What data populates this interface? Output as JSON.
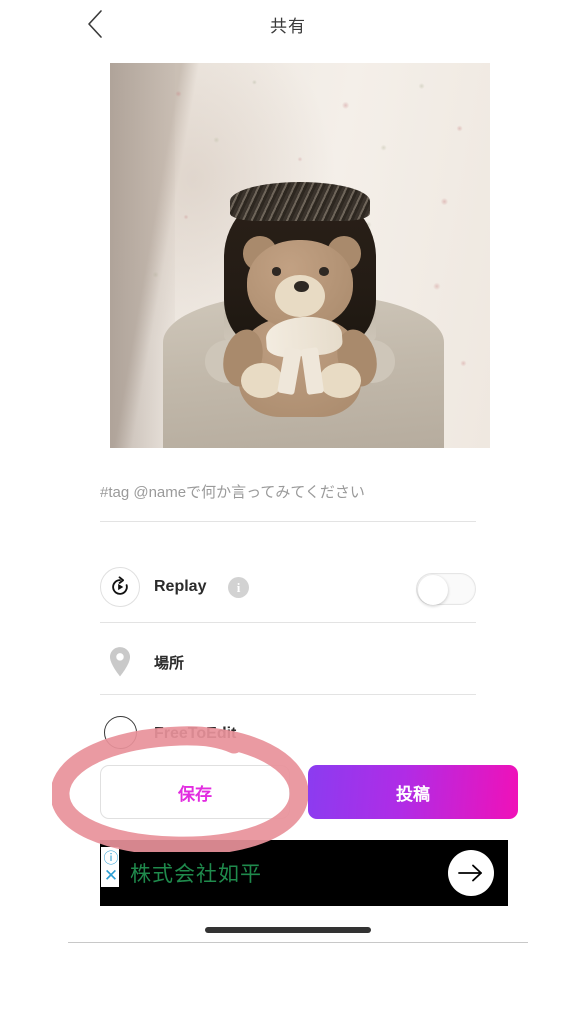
{
  "header": {
    "back_icon": "chevron-left-icon",
    "title": "共有"
  },
  "photo": {
    "alt": "person holding a teddy bear in front of floral wallpaper"
  },
  "caption": {
    "value": "",
    "placeholder": "#tag @nameで何か言ってみてください"
  },
  "options": [
    {
      "key": "replay",
      "icon": "replay-icon",
      "label": "Replay",
      "info_icon": "info-icon",
      "info_glyph": "i",
      "toggle": {
        "name": "replay-toggle",
        "state": "off"
      }
    },
    {
      "key": "place",
      "icon": "location-pin-icon",
      "label": "場所"
    },
    {
      "key": "freetoedit",
      "icon": "checkbox-unchecked-icon",
      "label": "FreeToEdit",
      "checked": false
    }
  ],
  "actions": {
    "save_label": "保存",
    "post_label": "投稿",
    "save_color": "#e22ce0",
    "post_gradient_start": "#8b3cf0",
    "post_gradient_end": "#f011b8"
  },
  "ad": {
    "text": "株式会社如平",
    "text_color": "#1f8a4c",
    "background": "#000000",
    "info_glyph": "ⓘ",
    "close_glyph": "✕",
    "arrow_icon": "arrow-right-icon"
  },
  "annotation": {
    "type": "hand-drawn-circle",
    "color": "#e8919a",
    "targets": "save-button"
  }
}
